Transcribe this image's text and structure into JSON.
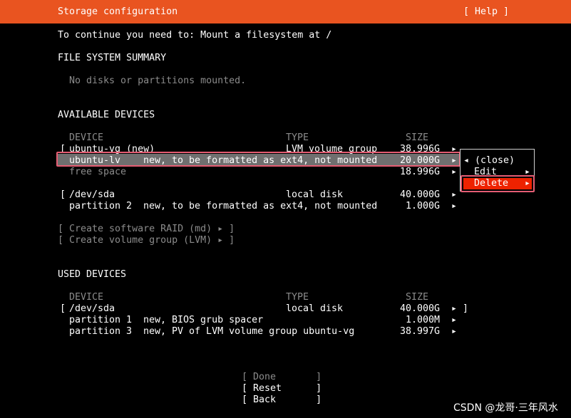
{
  "header": {
    "title": "Storage configuration",
    "help": "[ Help ]"
  },
  "instruction": "To continue you need to: Mount a filesystem at /",
  "fs_summary": {
    "heading": "FILE SYSTEM SUMMARY",
    "empty_text": "No disks or partitions mounted."
  },
  "available": {
    "heading": "AVAILABLE DEVICES",
    "columns": {
      "device": "DEVICE",
      "type": "TYPE",
      "size": "SIZE"
    },
    "rows": [
      {
        "bracket": "[",
        "device": "ubuntu-vg (new)",
        "type": "LVM volume group",
        "size": "38.996G",
        "arrow": "▸"
      },
      {
        "bracket": "",
        "device": "ubuntu-lv",
        "type": "new, to be formatted as ext4, not mounted",
        "size": "20.000G",
        "arrow": "▸"
      },
      {
        "bracket": "",
        "device": "free space",
        "type": "",
        "size": "18.996G",
        "arrow": "▸"
      },
      {
        "bracket": "[",
        "device": "/dev/sda",
        "type": "local disk",
        "size": "40.000G",
        "arrow": "▸"
      },
      {
        "bracket": "",
        "device": "partition 2",
        "type": "new, to be formatted as ext4, not mounted",
        "size": "1.000G",
        "arrow": "▸"
      }
    ],
    "actions": [
      "[ Create software RAID (md) ▸ ]",
      "[ Create volume group (LVM) ▸ ]"
    ]
  },
  "used": {
    "heading": "USED DEVICES",
    "columns": {
      "device": "DEVICE",
      "type": "TYPE",
      "size": "SIZE"
    },
    "rows": [
      {
        "bracket": "[",
        "device": "/dev/sda",
        "type": "local disk",
        "size": "40.000G",
        "arrow": "▸ ]"
      },
      {
        "bracket": "",
        "device": "partition 1",
        "type": "new, BIOS grub spacer",
        "size": "1.000M",
        "arrow": "▸"
      },
      {
        "bracket": "",
        "device": "partition 3",
        "type": "new, PV of LVM volume group ubuntu-vg",
        "size": "38.997G",
        "arrow": "▸"
      }
    ]
  },
  "popup_menu": {
    "items": [
      "◂ (close)",
      "Edit",
      "Delete"
    ],
    "item_arrows": [
      "",
      "▸",
      "▸"
    ]
  },
  "buttons": {
    "done": "[ Done       ]",
    "reset": "[ Reset      ]",
    "back": "[ Back       ]"
  },
  "watermark": "CSDN @龙哥·三年风水",
  "colors": {
    "header_bg": "#e95420",
    "selected_row_bg": "#6f6f6f",
    "delete_highlight": "#ee2200",
    "annotation_box": "#e55d73"
  }
}
